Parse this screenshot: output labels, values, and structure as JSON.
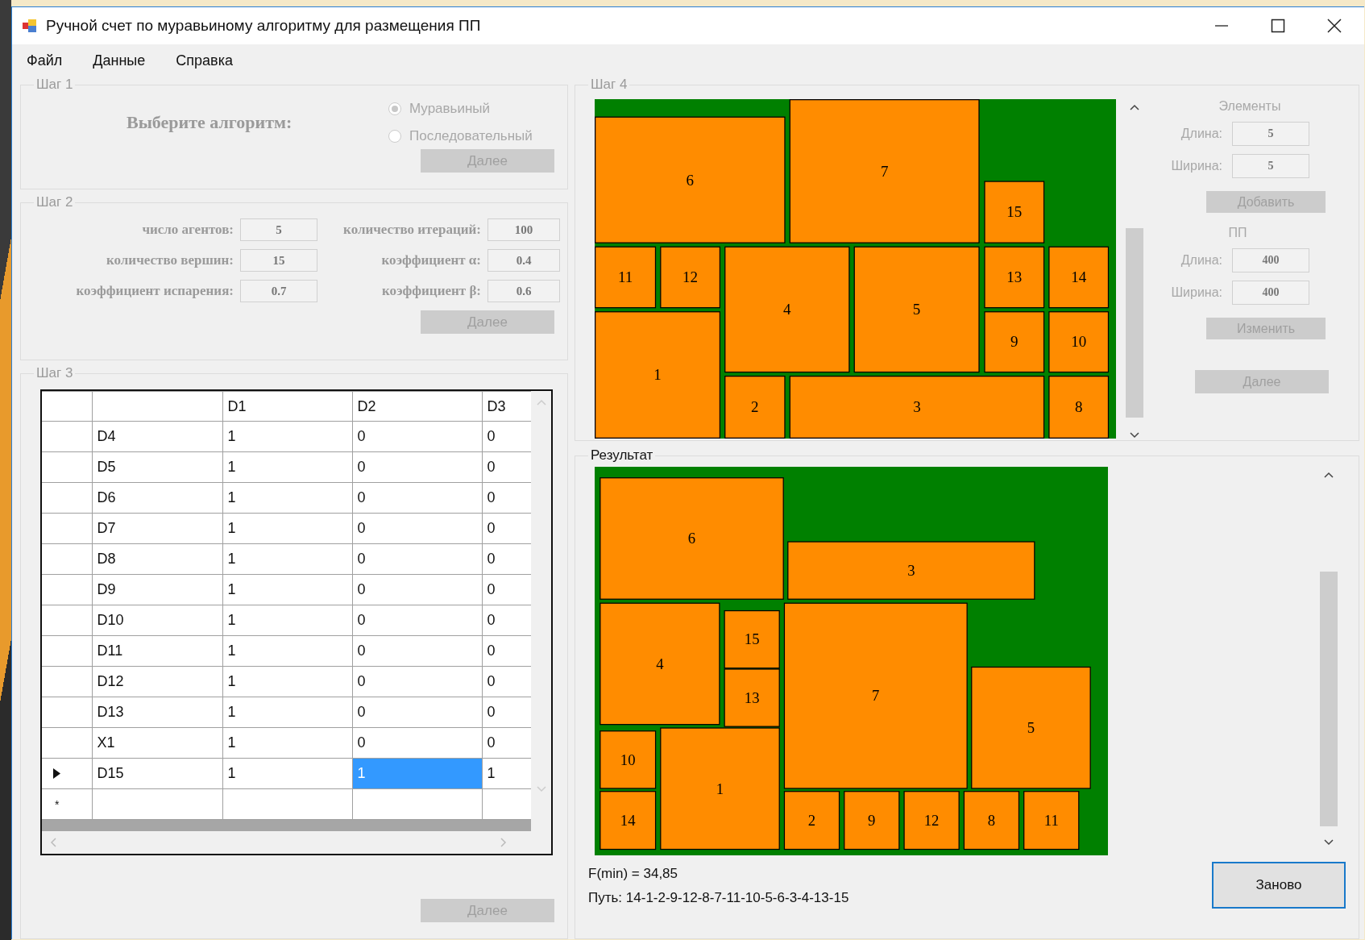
{
  "window": {
    "title": "Ручной счет по муравьиному алгоритму для размещения ПП"
  },
  "menu": [
    {
      "label": "Файл"
    },
    {
      "label": "Данные"
    },
    {
      "label": "Справка"
    }
  ],
  "step1": {
    "title": "Шаг 1",
    "prompt": "Выберите алгоритм:",
    "options": [
      {
        "label": "Муравьиный",
        "selected": true
      },
      {
        "label": "Последовательный",
        "selected": false
      }
    ],
    "button": {
      "label": "Далее",
      "disabled": true
    }
  },
  "step2": {
    "title": "Шаг 2",
    "fields": [
      {
        "label": "число агентов:",
        "value": "5"
      },
      {
        "label": "количество итераций:",
        "value": "100"
      },
      {
        "label": "количество вершин:",
        "value": "15"
      },
      {
        "label": "коэффициент α:",
        "value": "0.4"
      },
      {
        "label": "коэффициент испарения:",
        "value": "0.7"
      },
      {
        "label": "коэффициент  β:",
        "value": "0.6"
      }
    ],
    "button": {
      "label": "Далее",
      "disabled": true
    }
  },
  "step3": {
    "title": "Шаг 3",
    "columns": [
      "D1",
      "D2",
      "D3"
    ],
    "rows": [
      {
        "current": false,
        "name": "D4",
        "cells": [
          {
            "value": "1",
            "selected": false
          },
          {
            "value": "0",
            "selected": false
          },
          {
            "value": "0",
            "selected": false
          }
        ]
      },
      {
        "current": false,
        "name": "D5",
        "cells": [
          {
            "value": "1",
            "selected": false
          },
          {
            "value": "0",
            "selected": false
          },
          {
            "value": "0",
            "selected": false
          }
        ]
      },
      {
        "current": false,
        "name": "D6",
        "cells": [
          {
            "value": "1",
            "selected": false
          },
          {
            "value": "0",
            "selected": false
          },
          {
            "value": "0",
            "selected": false
          }
        ]
      },
      {
        "current": false,
        "name": "D7",
        "cells": [
          {
            "value": "1",
            "selected": false
          },
          {
            "value": "0",
            "selected": false
          },
          {
            "value": "0",
            "selected": false
          }
        ]
      },
      {
        "current": false,
        "name": "D8",
        "cells": [
          {
            "value": "1",
            "selected": false
          },
          {
            "value": "0",
            "selected": false
          },
          {
            "value": "0",
            "selected": false
          }
        ]
      },
      {
        "current": false,
        "name": "D9",
        "cells": [
          {
            "value": "1",
            "selected": false
          },
          {
            "value": "0",
            "selected": false
          },
          {
            "value": "0",
            "selected": false
          }
        ]
      },
      {
        "current": false,
        "name": "D10",
        "cells": [
          {
            "value": "1",
            "selected": false
          },
          {
            "value": "0",
            "selected": false
          },
          {
            "value": "0",
            "selected": false
          }
        ]
      },
      {
        "current": false,
        "name": "D11",
        "cells": [
          {
            "value": "1",
            "selected": false
          },
          {
            "value": "0",
            "selected": false
          },
          {
            "value": "0",
            "selected": false
          }
        ]
      },
      {
        "current": false,
        "name": "D12",
        "cells": [
          {
            "value": "1",
            "selected": false
          },
          {
            "value": "0",
            "selected": false
          },
          {
            "value": "0",
            "selected": false
          }
        ]
      },
      {
        "current": false,
        "name": "D13",
        "cells": [
          {
            "value": "1",
            "selected": false
          },
          {
            "value": "0",
            "selected": false
          },
          {
            "value": "0",
            "selected": false
          }
        ]
      },
      {
        "current": false,
        "name": "X1",
        "cells": [
          {
            "value": "1",
            "selected": false
          },
          {
            "value": "0",
            "selected": false
          },
          {
            "value": "0",
            "selected": false
          }
        ]
      },
      {
        "current": true,
        "name": "D15",
        "cells": [
          {
            "value": "1",
            "selected": false
          },
          {
            "value": "1",
            "selected": true
          },
          {
            "value": "1",
            "selected": false
          }
        ]
      }
    ],
    "new_row_marker": "*",
    "button": {
      "label": "Далее",
      "disabled": true
    }
  },
  "step4": {
    "title": "Шаг 4",
    "pieces": [
      "6",
      "7",
      "15",
      "11",
      "12",
      "4",
      "5",
      "13",
      "14",
      "1",
      "9",
      "10",
      "2",
      "3",
      "8"
    ],
    "elements": {
      "heading": "Элементы",
      "fields": [
        {
          "label": "Длина:",
          "value": "5"
        },
        {
          "label": "Ширина:",
          "value": "5"
        }
      ],
      "button": {
        "label": "Добавить",
        "disabled": true
      }
    },
    "board": {
      "heading": "ПП",
      "fields": [
        {
          "label": "Длина:",
          "value": "400"
        },
        {
          "label": "Ширина:",
          "value": "400"
        }
      ],
      "button": {
        "label": "Изменить",
        "disabled": true
      }
    },
    "button": {
      "label": "Далее",
      "disabled": true
    }
  },
  "result": {
    "title": "Результат",
    "pieces": [
      "6",
      "3",
      "4",
      "15",
      "13",
      "7",
      "5",
      "10",
      "1",
      "14",
      "2",
      "9",
      "12",
      "8",
      "11"
    ],
    "fmin": "F(min) = 34,85",
    "path": "Путь: 14-1-2-9-12-8-7-11-10-5-6-3-4-13-15",
    "button": {
      "label": "Заново",
      "disabled": false
    }
  }
}
